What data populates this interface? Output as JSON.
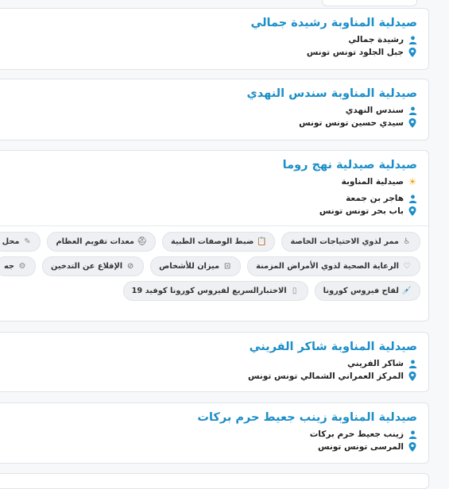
{
  "pharmacies": [
    {
      "title": "صيدلية المناوبة رشيدة جمالي",
      "owner": "رشيدة جمالي",
      "address": "جبل الجلود تونس تونس"
    },
    {
      "title": "صيدلية المناوبة سندس النهدي",
      "owner": "سندس النهدي",
      "address": "سيدي حسين تونس تونس"
    },
    {
      "title": "صيدلية صيدلية نهج روما",
      "status": "صيدلية المناوبة",
      "owner": "هاجر بن جمعة",
      "address": "باب بحر تونس تونس",
      "services": [
        [
          "ممر لذوي الاحتياجات الخاصة",
          "ضبط الوصفات الطبية",
          "معدات تقويم العظام",
          "محل"
        ],
        [
          "الرعاية الصحية لذوي الأمراض المزمنة",
          "ميزان للأشخاص",
          "الإقلاع عن التدخين",
          "جه"
        ],
        [
          "لقاح فيروس كورونا",
          "الاختبارالسريع لفيروس كورونا كوفيد 19"
        ]
      ]
    },
    {
      "title": "صيدلية المناوبة شاكر الفريني",
      "owner": "شاكر الفريني",
      "address": "المركز العمراني الشمالي تونس تونس"
    },
    {
      "title": "صيدلية المناوبة زينب جعيط حرم بركات",
      "owner": "زينب جعيط حرم بركات",
      "address": "المرسى تونس تونس"
    }
  ],
  "colors": {
    "title": "#1b8ec8",
    "icon": "#1b8ec8",
    "sun": "#f4a30a"
  }
}
